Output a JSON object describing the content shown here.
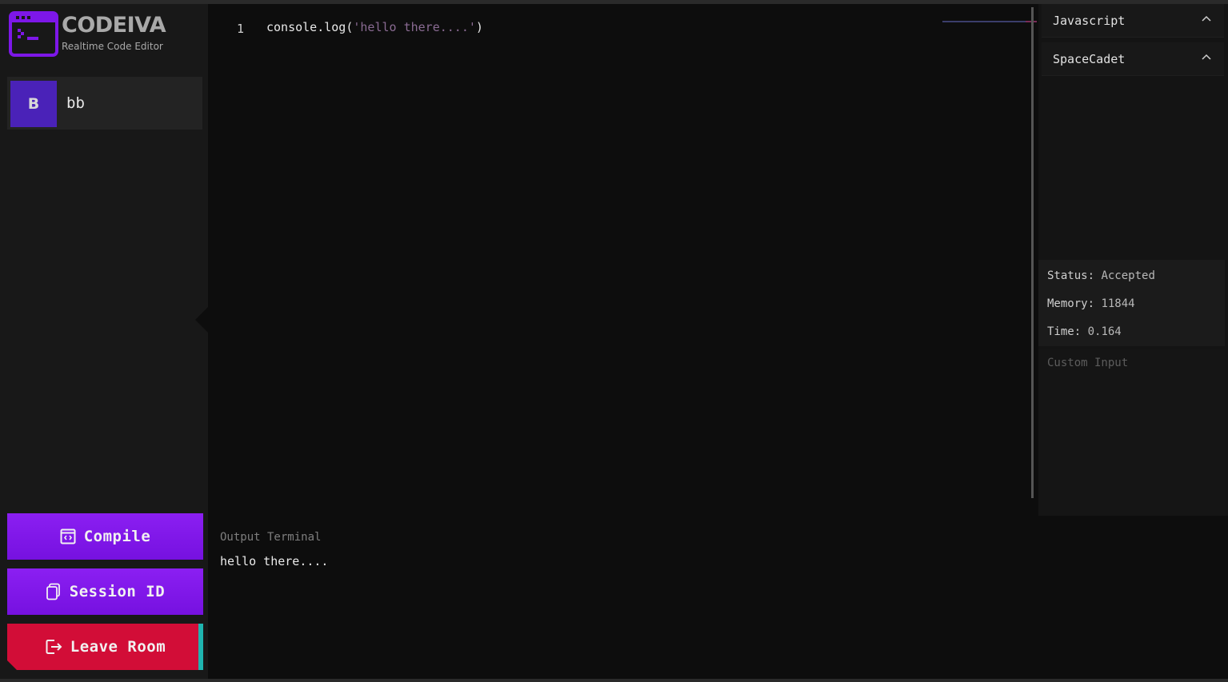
{
  "app": {
    "name": "CODEIVA",
    "tagline": "Realtime Code Editor",
    "accent": "#7d17e8",
    "danger": "#d20d37"
  },
  "clients": [
    {
      "initial": "B",
      "name": "bb",
      "avatar_color": "#4a22b8"
    }
  ],
  "actions": {
    "compile": "Compile",
    "session": "Session ID",
    "leave": "Leave Room"
  },
  "editor": {
    "line_number": "1",
    "code_prefix": "console.log(",
    "code_string": "'hello there....'",
    "code_suffix": ")"
  },
  "settings": {
    "language": "Javascript",
    "theme": "SpaceCadet"
  },
  "result": {
    "status_label": "Status:",
    "status_value": "Accepted",
    "memory_label": "Memory:",
    "memory_value": "11844",
    "time_label": "Time:",
    "time_value": "0.164"
  },
  "custom_input": {
    "placeholder": "Custom Input"
  },
  "output": {
    "title": "Output Terminal",
    "text": "hello there...."
  }
}
